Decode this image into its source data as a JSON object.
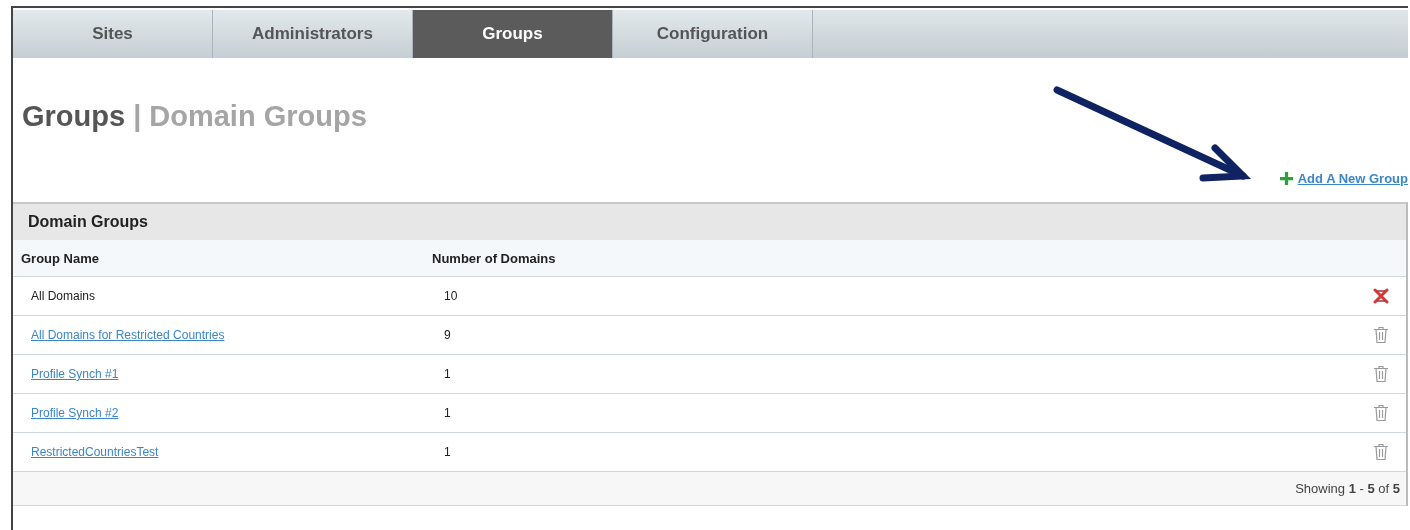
{
  "tabs": [
    {
      "label": "Sites",
      "selected": false
    },
    {
      "label": "Administrators",
      "selected": false
    },
    {
      "label": "Groups",
      "selected": true
    },
    {
      "label": "Configuration",
      "selected": false
    }
  ],
  "heading": {
    "section": "Groups",
    "separator": "|",
    "page": "Domain Groups"
  },
  "add_link": {
    "label": "Add A New Group"
  },
  "table": {
    "title": "Domain Groups",
    "columns": [
      "Group Name",
      "Number of Domains"
    ],
    "rows": [
      {
        "name": "All Domains",
        "linked": false,
        "count": "10",
        "deletable": false
      },
      {
        "name": "All Domains for Restricted Countries",
        "linked": true,
        "count": "9",
        "deletable": true
      },
      {
        "name": "Profile Synch #1",
        "linked": true,
        "count": "1",
        "deletable": true
      },
      {
        "name": "Profile Synch #2",
        "linked": true,
        "count": "1",
        "deletable": true
      },
      {
        "name": "RestrictedCountriesTest",
        "linked": true,
        "count": "1",
        "deletable": true
      }
    ],
    "footer": "Showing **1** - **5** of **5**"
  }
}
